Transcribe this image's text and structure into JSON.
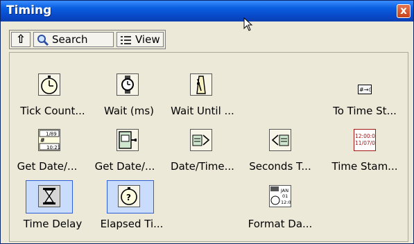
{
  "window": {
    "title": "Timing",
    "close_glyph": "x"
  },
  "toolbar": {
    "up_glyph": "⇧",
    "search_label": "Search",
    "view_label": "View"
  },
  "palette": {
    "items": [
      {
        "label": "Tick Count...",
        "icon": "stopwatch-icon"
      },
      {
        "label": "Wait (ms)",
        "icon": "wristwatch-icon"
      },
      {
        "label": "Wait Until ...",
        "icon": "metronome-icon"
      },
      {
        "label": "To Time St...",
        "icon": "to-time-stamp-icon"
      },
      {
        "label": "Get Date/...",
        "icon": "date-time-string-icon",
        "icon_text": [
          "1/89",
          "10:21"
        ]
      },
      {
        "label": "Get Date/...",
        "icon": "calendar-output-icon"
      },
      {
        "label": "Date/Time...",
        "icon": "date-time-to-seconds-icon"
      },
      {
        "label": "Seconds T...",
        "icon": "seconds-to-date-time-icon"
      },
      {
        "label": "Time Stam...",
        "icon": "time-stamp-constant-icon",
        "icon_text": [
          "12:00:01",
          "11/07/01"
        ]
      },
      {
        "label": "Time Delay",
        "icon": "hourglass-icon"
      },
      {
        "label": "Elapsed Ti...",
        "icon": "elapsed-time-icon"
      },
      {
        "label": "Format Da...",
        "icon": "format-date-icon",
        "icon_text": [
          "JAN",
          "01",
          "12:01"
        ]
      }
    ]
  },
  "colors": {
    "titlebar": "#0a5fe0",
    "selection": "#c9dcfb",
    "close": "#d9542b",
    "time_stamp": "#a31515"
  }
}
